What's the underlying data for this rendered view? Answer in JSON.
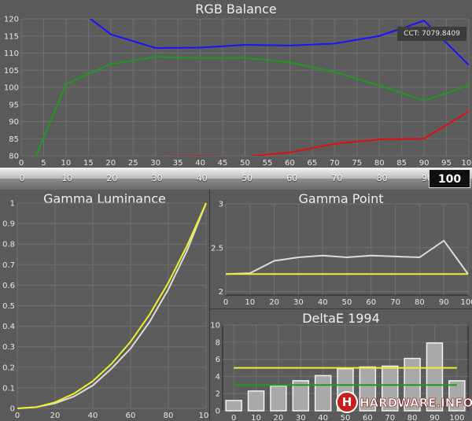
{
  "charts": {
    "rgb": {
      "title": "RGB Balance",
      "cct": "CCT: 7079.8409",
      "slider": {
        "labels": [
          "0",
          "10",
          "20",
          "30",
          "40",
          "50",
          "60",
          "70",
          "80",
          "90"
        ],
        "value": "100"
      }
    },
    "gamma_luminance": {
      "title": "Gamma Luminance"
    },
    "gamma_point": {
      "title": "Gamma Point"
    },
    "deltae": {
      "title": "DeltaE 1994"
    }
  },
  "logo": {
    "text": "HARDWARE.INFO",
    "h_letter": "H"
  },
  "colors": {
    "panel": "#5a5a5a",
    "grid": "#707070",
    "red": "#e01010",
    "green": "#1f9a1f",
    "blue": "#1414ff",
    "yellow": "#f0f02a",
    "white": "#dcdcdc"
  },
  "chart_data": [
    {
      "type": "line",
      "title": "RGB Balance",
      "x": [
        0,
        5,
        10,
        15,
        20,
        25,
        30,
        35,
        40,
        45,
        50,
        55,
        60,
        65,
        70,
        75,
        80,
        85,
        90,
        95,
        100
      ],
      "ylim": [
        80,
        120
      ],
      "xlim": [
        0,
        100
      ],
      "annotations": [
        "CCT: 7079.8409"
      ],
      "xlabel": "",
      "ylabel": "",
      "series": [
        {
          "color": "blue",
          "x": [
            15,
            20,
            30,
            40,
            50,
            60,
            70,
            80,
            90,
            100
          ],
          "values": [
            120.5,
            115.5,
            111.5,
            111.6,
            112.4,
            112.2,
            112.8,
            115,
            119.5,
            106.5
          ]
        },
        {
          "color": "green",
          "x": [
            3,
            10,
            20,
            30,
            40,
            50,
            60,
            70,
            80,
            90,
            100
          ],
          "values": [
            79,
            101,
            106.8,
            108.9,
            108.6,
            108.6,
            107.3,
            104.5,
            100.6,
            96.1,
            100.6
          ]
        },
        {
          "color": "red",
          "x": [
            30,
            40,
            50,
            60,
            70,
            80,
            90,
            100
          ],
          "values": [
            79.8,
            79.9,
            79.7,
            81,
            83.5,
            84.8,
            85,
            93
          ]
        }
      ]
    },
    {
      "type": "line",
      "title": "Gamma Luminance",
      "xlim": [
        0,
        100
      ],
      "ylim": [
        0,
        1
      ],
      "xlabel": "",
      "ylabel": "",
      "series": [
        {
          "color": "yellow",
          "x": [
            0,
            10,
            20,
            30,
            40,
            50,
            60,
            70,
            80,
            90,
            100
          ],
          "values": [
            0,
            0.006,
            0.03,
            0.072,
            0.133,
            0.218,
            0.325,
            0.456,
            0.612,
            0.794,
            1
          ]
        },
        {
          "color": "white",
          "x": [
            0,
            10,
            20,
            30,
            40,
            50,
            60,
            70,
            80,
            90,
            100
          ],
          "values": [
            0,
            0.006,
            0.025,
            0.058,
            0.112,
            0.195,
            0.292,
            0.42,
            0.58,
            0.77,
            1
          ]
        }
      ]
    },
    {
      "type": "line",
      "title": "Gamma Point",
      "xlim": [
        0,
        100
      ],
      "ylim": [
        1.96,
        3
      ],
      "xlabel": "",
      "ylabel": "",
      "series": [
        {
          "color": "yellow",
          "x": [
            0,
            100
          ],
          "values": [
            2.2,
            2.2
          ]
        },
        {
          "color": "white",
          "x": [
            0,
            10,
            20,
            30,
            40,
            50,
            60,
            70,
            80,
            90,
            100
          ],
          "values": [
            2.2,
            2.21,
            2.35,
            2.39,
            2.41,
            2.39,
            2.41,
            2.4,
            2.39,
            2.58,
            2.2
          ]
        }
      ]
    },
    {
      "type": "bar",
      "title": "DeltaE 1994",
      "categories": [
        "0",
        "10",
        "20",
        "30",
        "40",
        "50",
        "60",
        "70",
        "80",
        "90",
        "100"
      ],
      "values": [
        1.2,
        2.3,
        2.9,
        3.5,
        4.1,
        4.9,
        5.1,
        5.2,
        6.1,
        7.9,
        3.5
      ],
      "ylim": [
        0,
        10
      ],
      "reference_lines": [
        {
          "color": "yellow",
          "value": 5
        },
        {
          "color": "green",
          "value": 3
        }
      ],
      "xlabel": "",
      "ylabel": ""
    }
  ]
}
